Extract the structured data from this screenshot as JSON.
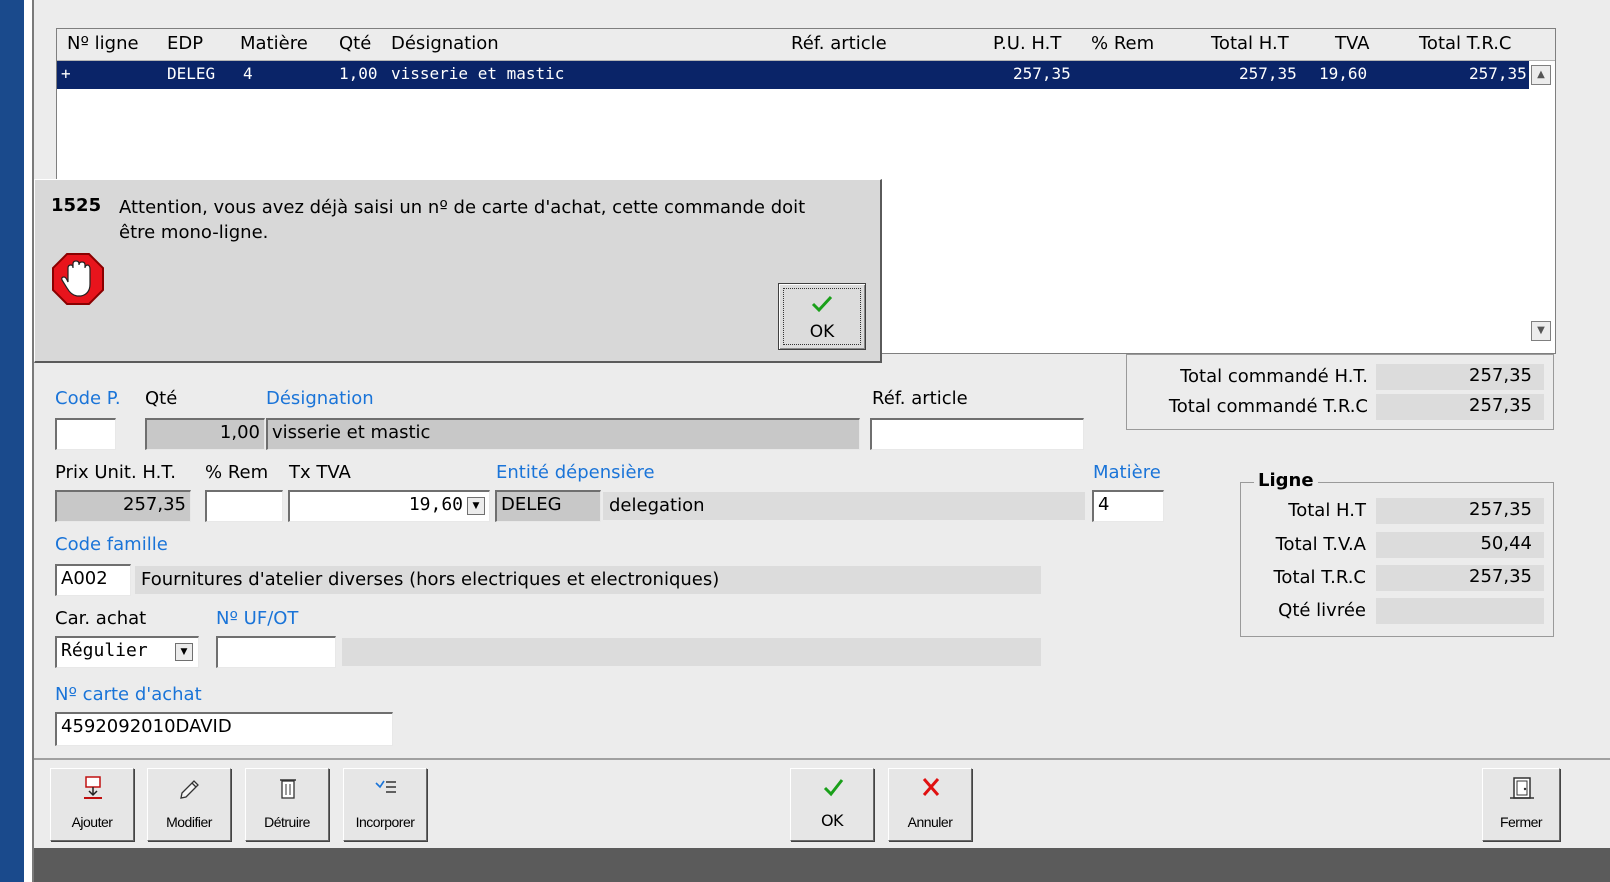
{
  "grid": {
    "headers": [
      "Nº ligne",
      "EDP",
      "Matière",
      "Qté",
      "Désignation",
      "Réf. article",
      "P.U. H.T",
      "% Rem",
      "Total H.T",
      "TVA",
      "Total T.R.C"
    ],
    "rows": [
      {
        "marker": "+",
        "edp": "DELEG",
        "matiere": "4",
        "qte": "1,00",
        "designation": "visserie et mastic",
        "ref": "",
        "pu": "257,35",
        "rem": "",
        "total_ht": "257,35",
        "tva": "19,60",
        "total_trc": "257,35"
      }
    ]
  },
  "dialog": {
    "code": "1525",
    "message": "Attention, vous avez déjà saisi un nº de carte d'achat, cette commande doit être mono-ligne.",
    "ok_label": "OK"
  },
  "totals": {
    "ht_label": "Total commandé H.T.",
    "ht_value": "257,35",
    "trc_label": "Total commandé T.R.C",
    "trc_value": "257,35"
  },
  "form": {
    "code_p_label": "Code P.",
    "code_p_value": "",
    "qte_label": "Qté",
    "qte_value": "1,00",
    "designation_label": "Désignation",
    "designation_value": "visserie et mastic",
    "ref_label": "Réf. article",
    "ref_value": "",
    "prix_label": "Prix Unit. H.T.",
    "prix_value": "257,35",
    "rem_label": "% Rem",
    "rem_value": "",
    "tva_label": "Tx TVA",
    "tva_value": "19,60",
    "entite_label": "Entité dépensière",
    "entite_code": "DELEG",
    "entite_name": "delegation",
    "matiere_label": "Matière",
    "matiere_value": "4",
    "famille_label": "Code famille",
    "famille_code": "A002",
    "famille_name": "Fournitures d'atelier diverses (hors electriques et electroniques)",
    "car_label": "Car. achat",
    "car_value": "Régulier",
    "uf_label": "Nº UF/OT",
    "uf_value": "",
    "uf_desc": "",
    "carte_label": "Nº carte d'achat",
    "carte_value": "4592092010DAVID"
  },
  "ligne": {
    "title": "Ligne",
    "total_ht_label": "Total H.T",
    "total_ht_value": "257,35",
    "total_tva_label": "Total T.V.A",
    "total_tva_value": "50,44",
    "total_trc_label": "Total T.R.C",
    "total_trc_value": "257,35",
    "qte_livree_label": "Qté livrée",
    "qte_livree_value": ""
  },
  "toolbar": {
    "ajouter": "Ajouter",
    "modifier": "Modifier",
    "detruire": "Détruire",
    "incorporer": "Incorporer",
    "ok": "OK",
    "annuler": "Annuler",
    "fermer": "Fermer"
  },
  "colors": {
    "selection": "#0a2468",
    "label_blue": "#1a74d8",
    "ok_green": "#1aa01a",
    "cancel_red": "#e01010",
    "stop_red": "#e8141c"
  }
}
